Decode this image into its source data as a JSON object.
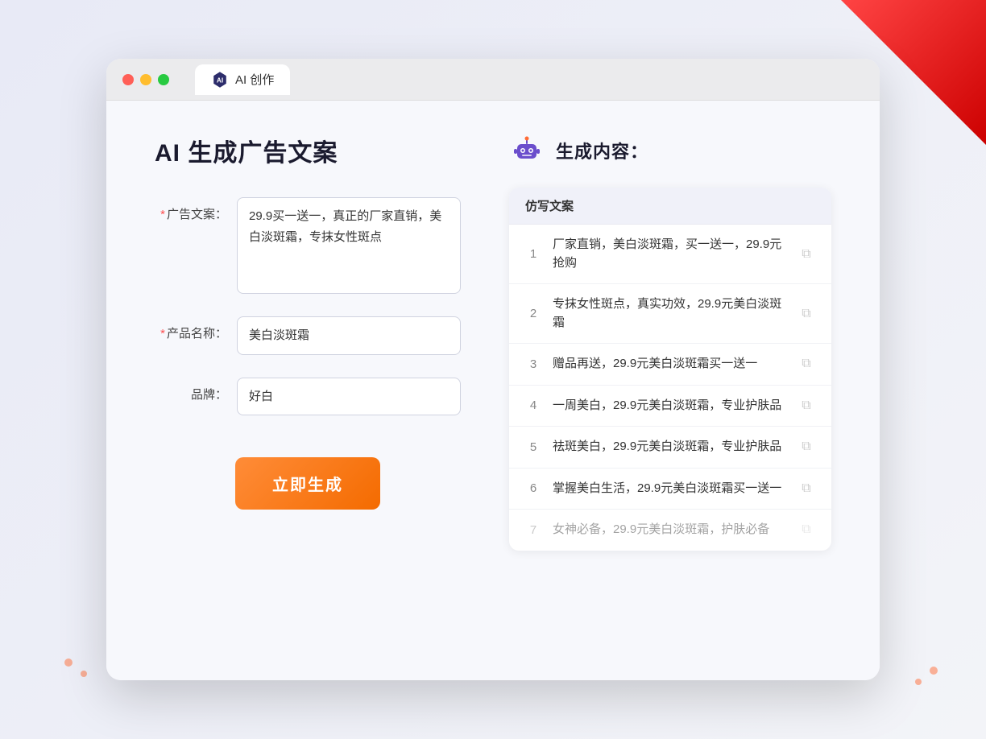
{
  "browser": {
    "tab_label": "AI 创作",
    "traffic_lights": [
      "red",
      "yellow",
      "green"
    ]
  },
  "left_panel": {
    "page_title": "AI 生成广告文案",
    "fields": [
      {
        "id": "ad_copy",
        "label": "广告文案：",
        "required": true,
        "type": "textarea",
        "value": "29.9买一送一，真正的厂家直销，美白淡斑霜，专抹女性斑点",
        "placeholder": ""
      },
      {
        "id": "product_name",
        "label": "产品名称：",
        "required": true,
        "type": "input",
        "value": "美白淡斑霜",
        "placeholder": ""
      },
      {
        "id": "brand",
        "label": "品牌：",
        "required": false,
        "type": "input",
        "value": "好白",
        "placeholder": ""
      }
    ],
    "generate_button_label": "立即生成"
  },
  "right_panel": {
    "title": "生成内容：",
    "column_header": "仿写文案",
    "results": [
      {
        "num": 1,
        "text": "厂家直销，美白淡斑霜，买一送一，29.9元抢购",
        "dimmed": false
      },
      {
        "num": 2,
        "text": "专抹女性斑点，真实功效，29.9元美白淡斑霜",
        "dimmed": false
      },
      {
        "num": 3,
        "text": "赠品再送，29.9元美白淡斑霜买一送一",
        "dimmed": false
      },
      {
        "num": 4,
        "text": "一周美白，29.9元美白淡斑霜，专业护肤品",
        "dimmed": false
      },
      {
        "num": 5,
        "text": "祛斑美白，29.9元美白淡斑霜，专业护肤品",
        "dimmed": false
      },
      {
        "num": 6,
        "text": "掌握美白生活，29.9元美白淡斑霜买一送一",
        "dimmed": false
      },
      {
        "num": 7,
        "text": "女神必备，29.9元美白淡斑霜，护肤必备",
        "dimmed": true
      }
    ]
  }
}
